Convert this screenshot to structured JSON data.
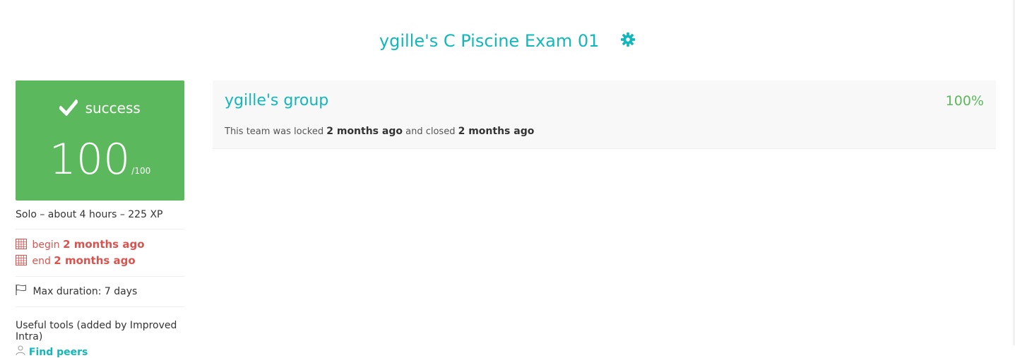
{
  "project": {
    "title": "ygille's C Piscine Exam 01",
    "settings_icon": "gear-icon",
    "accent_color": "#11b7bb"
  },
  "result": {
    "status": "success",
    "score": "100",
    "max_score": "/100",
    "status_color": "#5cb85c"
  },
  "info": {
    "summary": "Solo – about 4 hours – 225 XP",
    "begin_label": "begin",
    "begin_value": "2 months ago",
    "end_label": "end",
    "end_value": "2 months ago",
    "max_duration": "Max duration: 7 days",
    "tools_title": "Useful tools (added by Improved Intra)",
    "find_peers": "Find peers"
  },
  "group": {
    "name": "ygille's group",
    "percent": "100%",
    "desc_prefix": "This team was locked",
    "locked_when": "2 months ago",
    "desc_middle": "and closed",
    "closed_when": "2 months ago"
  }
}
